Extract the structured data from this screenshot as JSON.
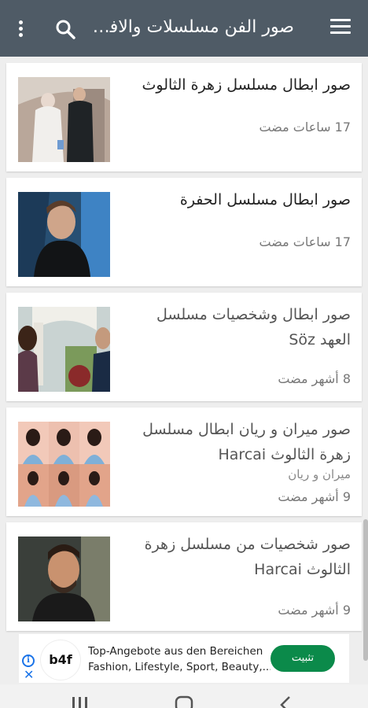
{
  "appbar": {
    "title": "صور الفن مسلسلات والافلام"
  },
  "items": [
    {
      "title": "صور ابطال مسلسل زهرة الثالوث",
      "subtitle": "",
      "time": "17 ساعات مضت"
    },
    {
      "title": "صور ابطال مسلسل الحفرة",
      "subtitle": "",
      "time": "17 ساعات مضت"
    },
    {
      "title": "صور ابطال وشخصيات مسلسل العهد Söz",
      "subtitle": "",
      "time": "8 أشهر مضت"
    },
    {
      "title": "صور ميران و ريان ابطال مسلسل زهرة الثالوث Harcai",
      "subtitle": "ميران و ريان",
      "time": "9 أشهر مضت"
    },
    {
      "title": "صور شخصيات من مسلسل زهرة الثالوث Harcai",
      "subtitle": "",
      "time": "9 أشهر مضت"
    }
  ],
  "ad": {
    "logo": "b4f",
    "line1": "Top-Angebote aus den Bereichen",
    "line2": "Fashion, Lifestyle, Sport, Beauty,...",
    "button": "تثبيت",
    "info_icon": "i",
    "close_icon": "✕"
  },
  "colors": {
    "appbar": "#4f5b66",
    "install": "#0b8a4a"
  }
}
